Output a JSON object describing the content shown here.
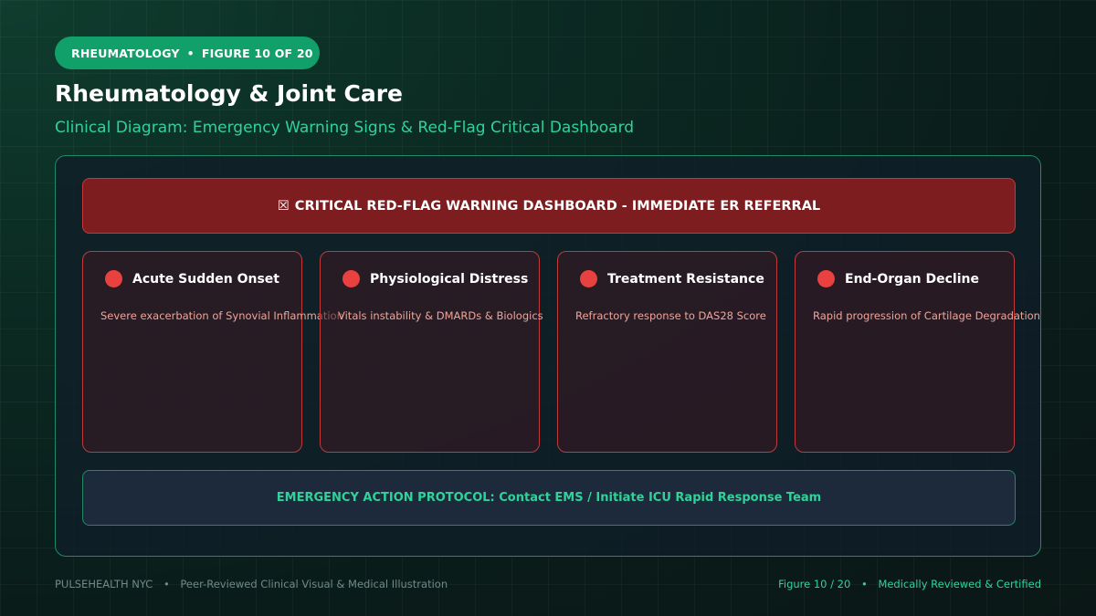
{
  "header": {
    "badge_category": "RHEUMATOLOGY",
    "badge_figure": "FIGURE 10 OF 20",
    "title": "Rheumatology & Joint Care",
    "subtitle": "Clinical Diagram: Emergency Warning Signs & Red-Flag Critical Dashboard"
  },
  "dashboard": {
    "alert_glyph": "☒",
    "alert_text": "CRITICAL RED-FLAG WARNING DASHBOARD - IMMEDIATE ER REFERRAL",
    "cards": [
      {
        "title": "Acute Sudden Onset",
        "desc": "Severe exacerbation of Synovial Inflammation"
      },
      {
        "title": "Physiological Distress",
        "desc": "Vitals instability & DMARDs & Biologics"
      },
      {
        "title": "Treatment Resistance",
        "desc": "Refractory response to DAS28 Score"
      },
      {
        "title": "End-Organ Decline",
        "desc": "Rapid progression of Cartilage Degradation"
      }
    ],
    "action_text": "EMERGENCY ACTION PROTOCOL: Contact EMS / Initiate ICU Rapid Response Team"
  },
  "footer": {
    "brand": "PULSEHEALTH NYC",
    "tagline": "Peer-Reviewed Clinical Visual & Medical Illustration",
    "figure": "Figure 10 / 20",
    "certification": "Medically Reviewed & Certified"
  },
  "colors": {
    "accent_green": "#2fd39a",
    "badge_green": "#12a06a",
    "alert_red": "#7d1d1f",
    "card_border_red": "#c2393b",
    "dot_red": "#e8413f"
  }
}
